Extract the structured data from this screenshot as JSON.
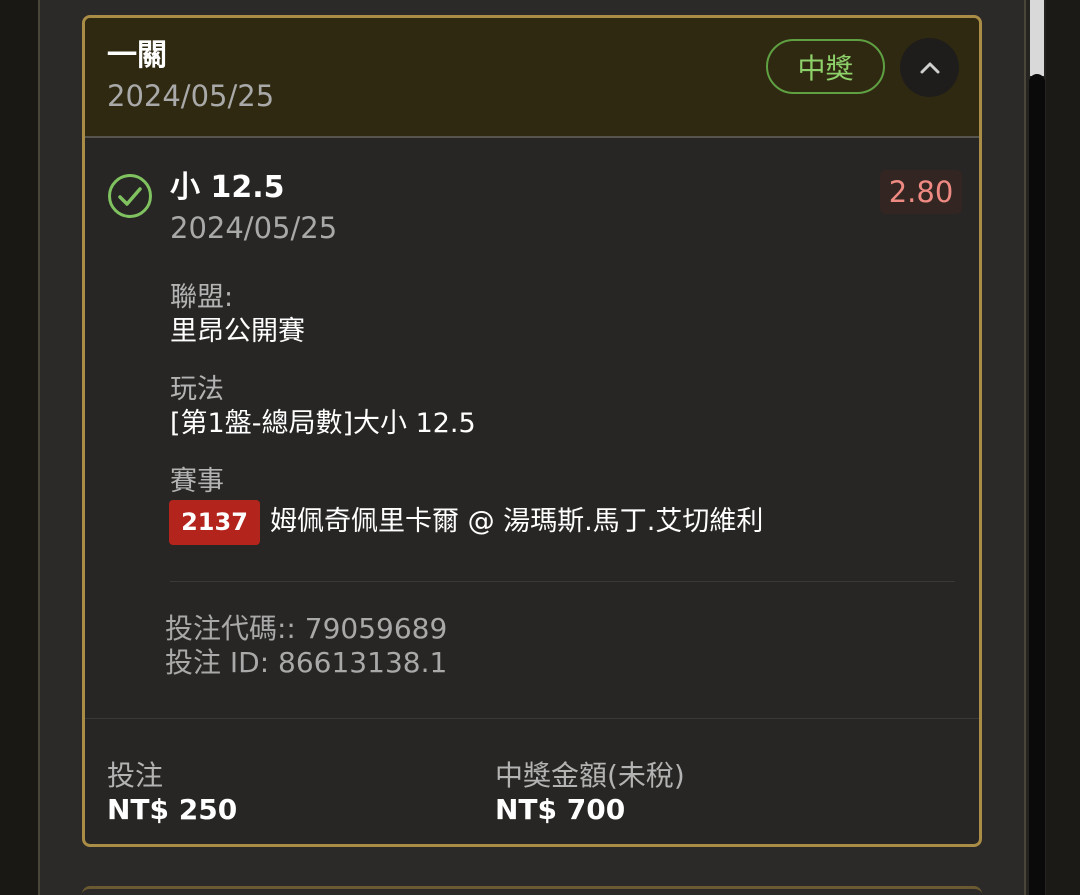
{
  "colors": {
    "accent_gold": "#a98c45",
    "win_green": "#8ed16b",
    "odds_red": "#ef8a82",
    "event_badge_red": "#b3241c"
  },
  "bet": {
    "type_title": "一關",
    "date": "2024/05/25",
    "status_badge": "中獎",
    "collapse_icon": "chevron-up-icon",
    "selection": {
      "status_icon": "check-circle-icon",
      "title": "小 12.5",
      "date": "2024/05/25",
      "odds": "2.80"
    },
    "league_label": "聯盟:",
    "league_value": "里昂公開賽",
    "market_label": "玩法",
    "market_value": "[第1盤-總局數]大小 12.5",
    "event_label": "賽事",
    "event_id": "2137",
    "event_name": "姆佩奇佩里卡爾 @ 湯瑪斯.馬丁.艾切維利",
    "bet_code": "投注代碼:: 79059689",
    "bet_id": "投注 ID: 86613138.1",
    "stake_label": "投注",
    "stake_value": "NT$ 250",
    "payout_label": "中獎金額(未稅)",
    "payout_value": "NT$ 700"
  }
}
